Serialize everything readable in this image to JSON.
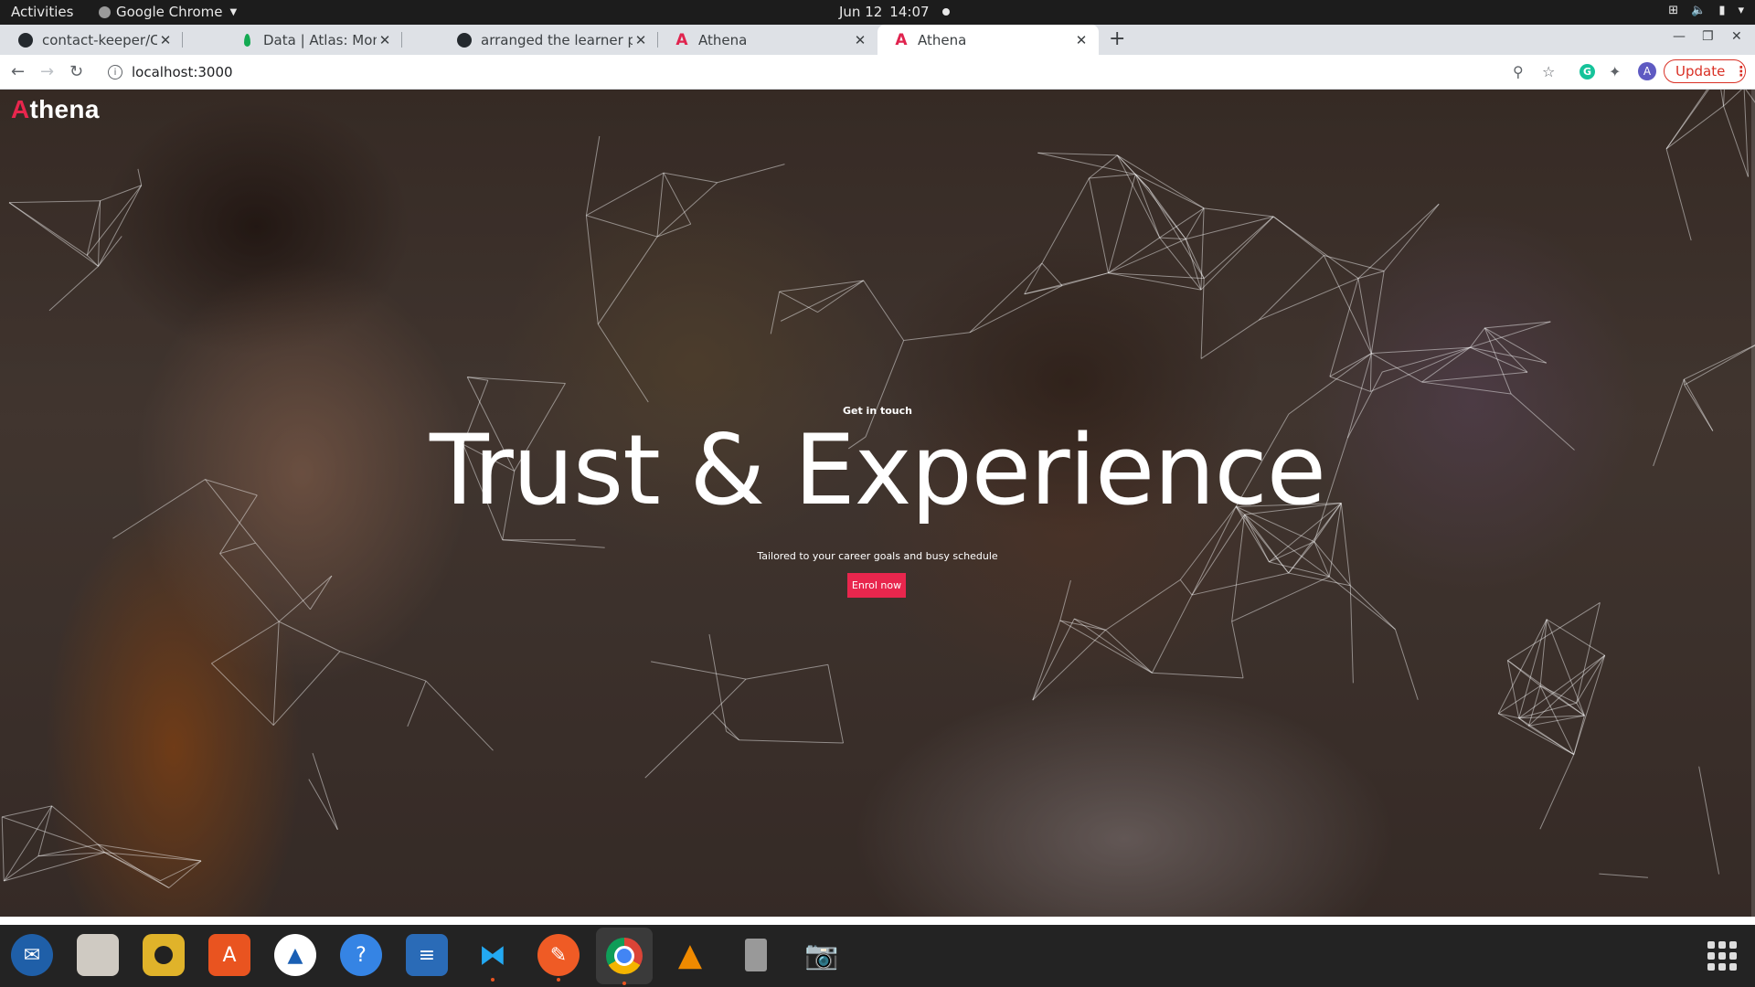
{
  "system_bar": {
    "activities": "Activities",
    "app_name": "Google Chrome",
    "date": "Jun 12",
    "time": "14:07"
  },
  "tabs": [
    {
      "title": "contact-keeper/Contacts.",
      "favicon": "github-icon",
      "active": false
    },
    {
      "title": "Data | Atlas: MongoDB At",
      "favicon": "mongodb-leaf-icon",
      "active": false
    },
    {
      "title": "arranged the learner prof",
      "favicon": "github-icon",
      "active": false
    },
    {
      "title": "Athena",
      "favicon": "athena-icon",
      "active": false
    },
    {
      "title": "Athena",
      "favicon": "athena-icon",
      "active": true
    }
  ],
  "address_bar": {
    "url": "localhost:3000",
    "update_label": "Update",
    "profile_initial": "A"
  },
  "page": {
    "brand_first": "A",
    "brand_rest": "thena",
    "kicker": "Get in touch",
    "headline": "Trust & Experience",
    "subline": "Tailored to your career goals and busy schedule",
    "cta": "Enrol now"
  },
  "colors": {
    "accent": "#e8264d",
    "chrome_tabstrip": "#dee1e6",
    "update_red": "#d93025"
  },
  "dock": [
    {
      "name": "thunderbird-icon",
      "running": false
    },
    {
      "name": "files-icon",
      "running": false
    },
    {
      "name": "rhythmbox-icon",
      "running": false
    },
    {
      "name": "ubuntu-software-icon",
      "running": false
    },
    {
      "name": "android-studio-icon",
      "running": false
    },
    {
      "name": "help-icon",
      "running": false
    },
    {
      "name": "libreoffice-writer-icon",
      "running": false
    },
    {
      "name": "vscode-icon",
      "running": true
    },
    {
      "name": "postman-icon",
      "running": true
    },
    {
      "name": "chrome-icon",
      "running": true
    },
    {
      "name": "vlc-icon",
      "running": false
    },
    {
      "name": "usb-device-icon",
      "running": false
    },
    {
      "name": "screenshot-camera-icon",
      "running": false
    }
  ]
}
